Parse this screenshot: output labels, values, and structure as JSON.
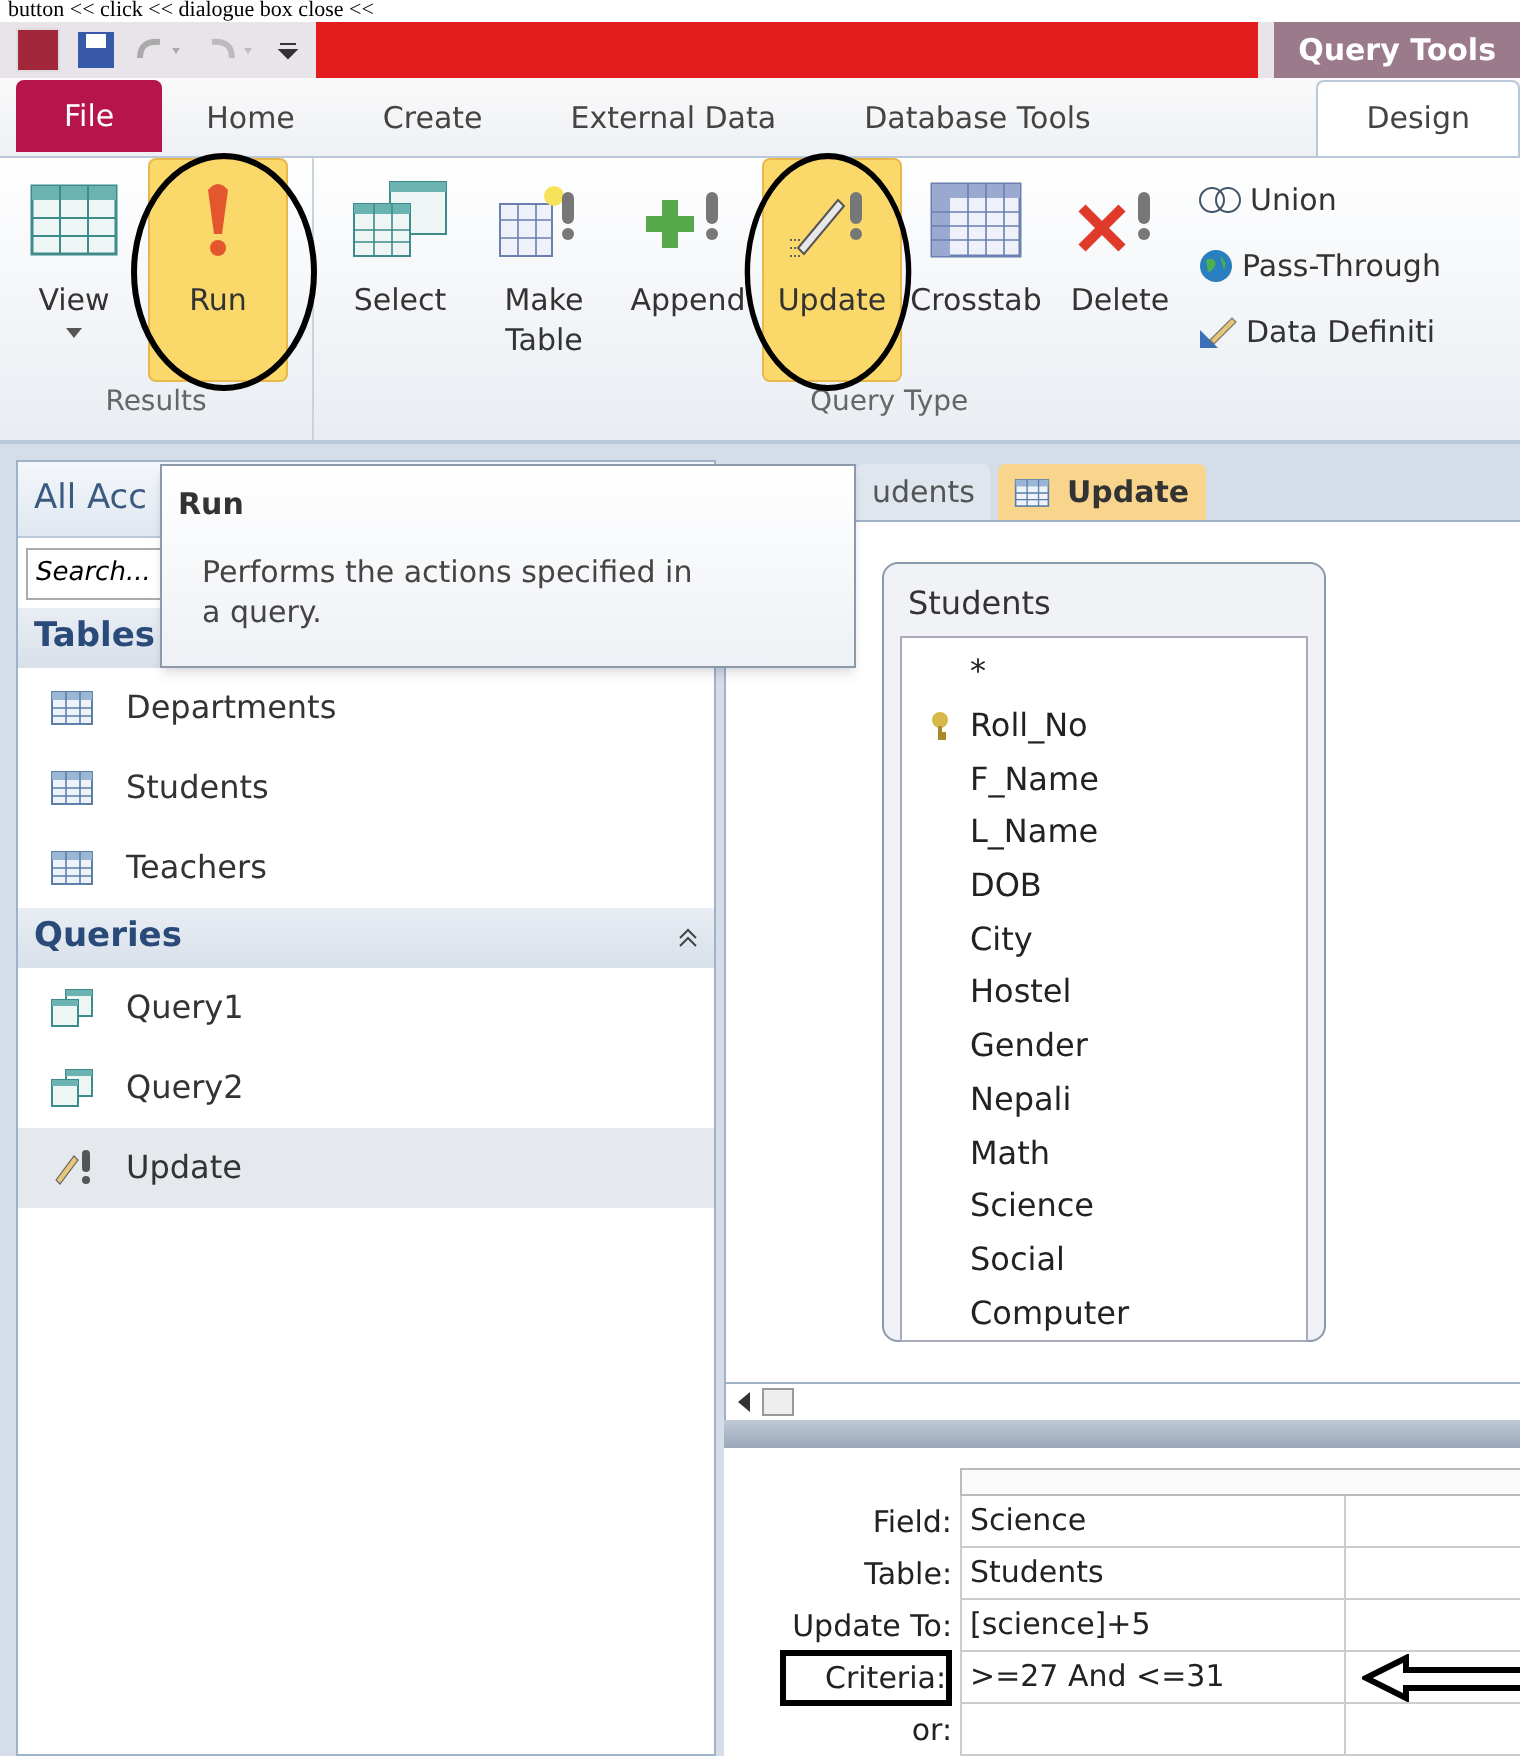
{
  "caption": "button << click << dialogue box close <<",
  "title_bar": {
    "context_label": "Query Tools"
  },
  "ribbon_tabs": [
    {
      "label": "File",
      "kind": "file",
      "selected": false
    },
    {
      "label": "Home",
      "kind": "tab",
      "selected": false
    },
    {
      "label": "Create",
      "kind": "tab",
      "selected": false
    },
    {
      "label": "External Data",
      "kind": "tab",
      "selected": false
    },
    {
      "label": "Database Tools",
      "kind": "tab",
      "selected": false
    },
    {
      "label": "Design",
      "kind": "tab",
      "selected": true
    }
  ],
  "ribbon_groups": [
    {
      "label": "Results",
      "buttons": [
        {
          "label": "View",
          "kind": "view",
          "highlighted": false,
          "dropdown": true
        },
        {
          "label": "Run",
          "kind": "run",
          "highlighted": true,
          "circled": true
        }
      ]
    },
    {
      "label": "Query Type",
      "buttons": [
        {
          "label": "Select",
          "kind": "select",
          "highlighted": false
        },
        {
          "label": "Make Table",
          "kind": "make_table",
          "highlighted": false
        },
        {
          "label": "Append",
          "kind": "append",
          "highlighted": false
        },
        {
          "label": "Update",
          "kind": "update",
          "highlighted": true,
          "circled": true
        },
        {
          "label": "Crosstab",
          "kind": "crosstab",
          "highlighted": false
        },
        {
          "label": "Delete",
          "kind": "delete",
          "highlighted": false
        }
      ],
      "small_buttons": [
        {
          "label": "Union",
          "kind": "union"
        },
        {
          "label": "Pass-Through",
          "kind": "globe"
        },
        {
          "label": "Data Definiti",
          "kind": "ruler"
        }
      ]
    }
  ],
  "tooltip": {
    "title": "Run",
    "text": "Performs the actions specified in a query."
  },
  "nav": {
    "header": "All Acc",
    "search": {
      "placeholder": "Search..."
    },
    "groups": [
      {
        "title": "Tables",
        "items": [
          {
            "label": "Departments",
            "kind": "table",
            "selected": false
          },
          {
            "label": "Students",
            "kind": "table",
            "selected": false
          },
          {
            "label": "Teachers",
            "kind": "table",
            "selected": false
          }
        ]
      },
      {
        "title": "Queries",
        "collapse_button": true,
        "items": [
          {
            "label": "Query1",
            "kind": "query",
            "selected": false
          },
          {
            "label": "Query2",
            "kind": "query",
            "selected": false
          },
          {
            "label": "Update",
            "kind": "update_query",
            "selected": true
          }
        ]
      }
    ]
  },
  "doc_tabs": [
    {
      "label": "udents",
      "selected": false
    },
    {
      "label": "Update",
      "selected": true
    }
  ],
  "table_box": {
    "title": "Students",
    "fields": [
      {
        "name": "*"
      },
      {
        "name": "Roll_No",
        "primary_key": true
      },
      {
        "name": "F_Name"
      },
      {
        "name": "L_Name"
      },
      {
        "name": "DOB"
      },
      {
        "name": "City"
      },
      {
        "name": "Hostel"
      },
      {
        "name": "Gender"
      },
      {
        "name": "Nepali"
      },
      {
        "name": "Math"
      },
      {
        "name": "Science"
      },
      {
        "name": "Social"
      },
      {
        "name": "Computer"
      }
    ]
  },
  "grid": {
    "rows": [
      {
        "label": "Field:",
        "value": "Science"
      },
      {
        "label": "Table:",
        "value": "Students"
      },
      {
        "label": "Update To:",
        "value": "[science]+5"
      },
      {
        "label": "Criteria:",
        "value": ">=27 And <=31",
        "boxed": true,
        "arrow": true
      },
      {
        "label": "or:"
      }
    ]
  }
}
